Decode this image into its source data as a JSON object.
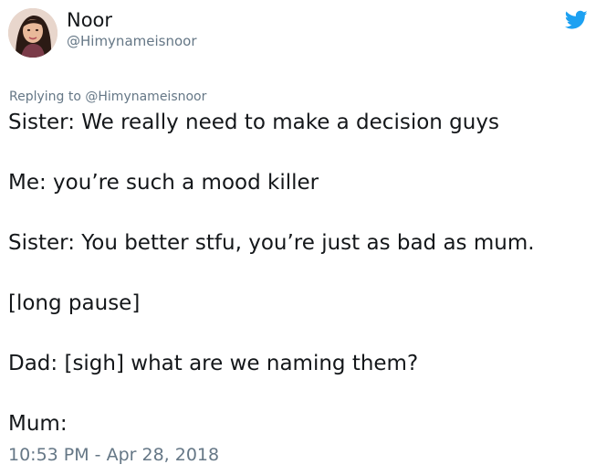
{
  "author": {
    "display_name": "Noor",
    "handle": "@Himynameisnoor"
  },
  "reply_context": {
    "prefix": "Replying to",
    "to_handle": "@Himynameisnoor"
  },
  "tweet": {
    "lines": [
      "Sister: We really need to make a decision guys",
      "Me: you’re such a mood killer",
      "Sister: You better stfu, you’re just as bad as mum.",
      "[long pause]",
      "Dad: [sigh] what are we naming them?",
      "Mum:"
    ],
    "timestamp": "10:53 PM - Apr 28, 2018"
  },
  "icons": {
    "brand": "twitter-bird-icon",
    "brand_color": "#1da1f2"
  },
  "colors": {
    "text": "#14171a",
    "secondary": "#657786"
  }
}
